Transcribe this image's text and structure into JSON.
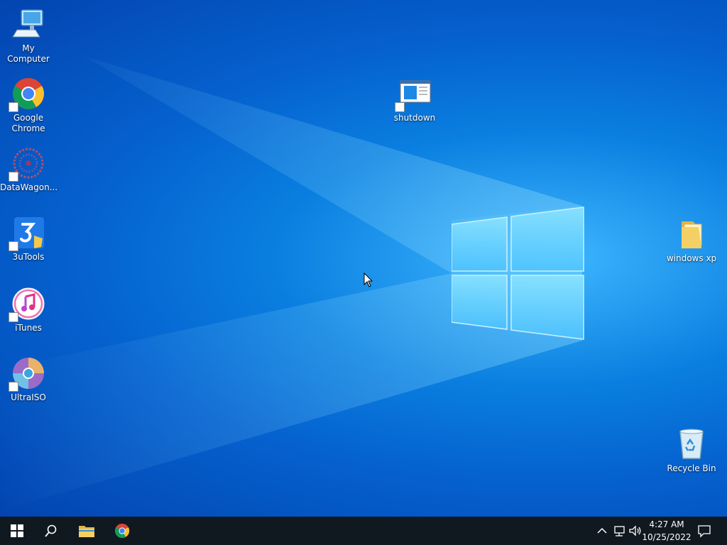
{
  "desktop": {
    "icons": [
      {
        "label": "My Computer",
        "icon": "computer-icon"
      },
      {
        "label": "Google Chrome",
        "icon": "chrome-icon"
      },
      {
        "label": "DataWagon...",
        "icon": "datawagon-icon"
      },
      {
        "label": "3uTools",
        "icon": "3utools-icon"
      },
      {
        "label": "iTunes",
        "icon": "itunes-icon"
      },
      {
        "label": "UltraISO",
        "icon": "ultraiso-icon"
      },
      {
        "label": "shutdown",
        "icon": "shutdown-icon"
      },
      {
        "label": "windows xp",
        "icon": "folder-icon"
      },
      {
        "label": "Recycle Bin",
        "icon": "recycle-bin-icon"
      }
    ]
  },
  "taskbar": {
    "start": "windows-start-icon",
    "search": "search-icon",
    "pinned": [
      "file-explorer-icon",
      "chrome-icon"
    ],
    "tray": [
      "chevron-up-icon",
      "network-icon",
      "volume-icon"
    ],
    "clock": {
      "time": "4:27 AM",
      "date": "10/25/2022"
    },
    "notification": "action-center-icon"
  },
  "colors": {
    "wallpaper": "#0a7fe0",
    "taskbar": "#101820",
    "text": "#ffffff"
  }
}
